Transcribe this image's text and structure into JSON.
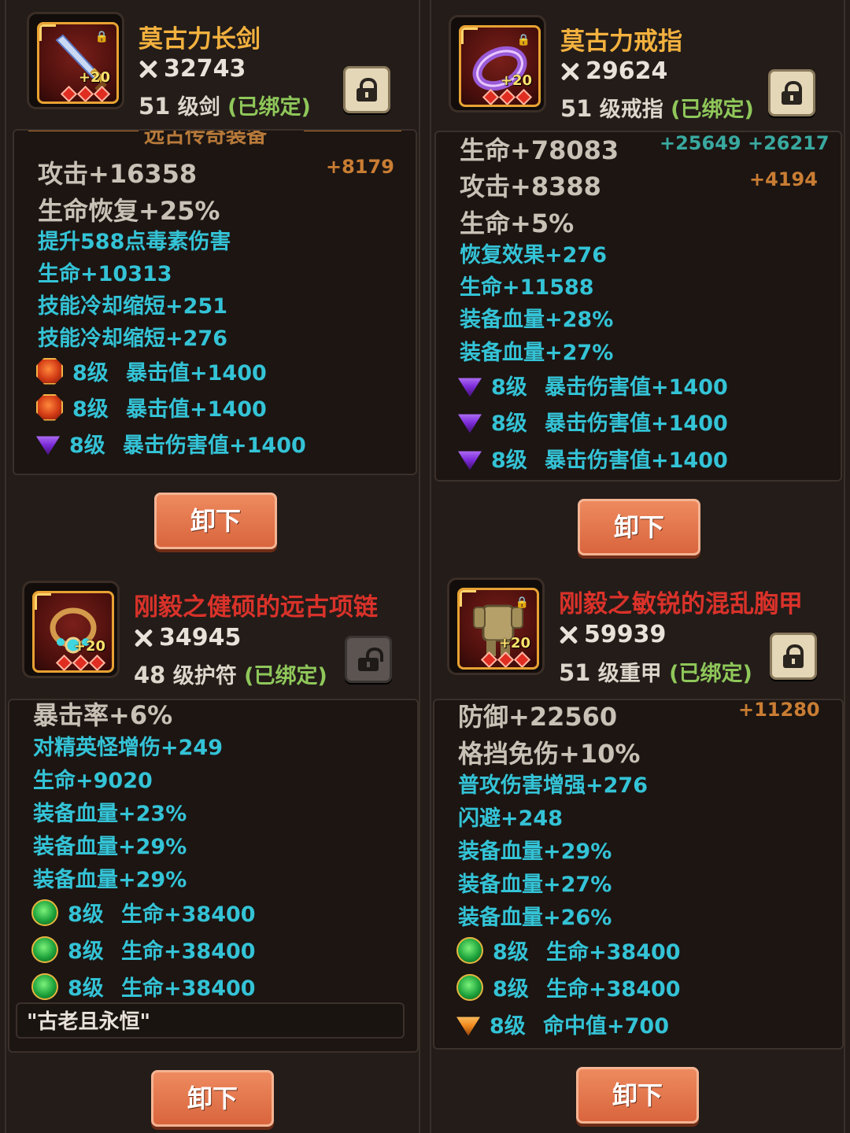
{
  "unequip_label": "卸下",
  "panels": [
    {
      "name": "莫古力长剑",
      "power": "32743",
      "level": "51",
      "level_text": " 级剑 ",
      "bound": "(已绑定)",
      "icon_level": "+20",
      "section_title": "远古传奇装备",
      "stats": [
        {
          "text": "攻击+16358",
          "bonus": "+8179"
        },
        {
          "text": "生命恢复+25%"
        },
        {
          "text": "提升588点毒素伤害"
        },
        {
          "text": "生命+10313"
        },
        {
          "text": "技能冷却缩短+251"
        },
        {
          "text": "技能冷却缩短+276"
        }
      ],
      "gems": [
        {
          "level": "8级",
          "text": "暴击值+1400",
          "icon": "red-gem-icon"
        },
        {
          "level": "8级",
          "text": "暴击值+1400",
          "icon": "red-gem-icon"
        },
        {
          "level": "8级",
          "text": "暴击伤害值+1400",
          "icon": "purple-gem-icon"
        }
      ]
    },
    {
      "name": "莫古力戒指",
      "power": "29624",
      "level": "51",
      "level_text": " 级戒指 ",
      "bound": "(已绑定)",
      "icon_level": "+20",
      "stats": [
        {
          "text": "生命+78083",
          "bonus": "+25649 +26217"
        },
        {
          "text": "攻击+8388",
          "bonus": "+4194"
        },
        {
          "text": "生命+5%"
        },
        {
          "text": "恢复效果+276"
        },
        {
          "text": "生命+11588"
        },
        {
          "text": "装备血量+28%"
        },
        {
          "text": "装备血量+27%"
        }
      ],
      "gems": [
        {
          "level": "8级",
          "text": "暴击伤害值+1400",
          "icon": "purple-gem-icon"
        },
        {
          "level": "8级",
          "text": "暴击伤害值+1400",
          "icon": "purple-gem-icon"
        },
        {
          "level": "8级",
          "text": "暴击伤害值+1400",
          "icon": "purple-gem-icon"
        }
      ]
    },
    {
      "name": "刚毅之健硕的远古项链",
      "power": "34945",
      "level": "48",
      "level_text": " 级护符 ",
      "bound": "(已绑定)",
      "icon_level": "+20",
      "stats": [
        {
          "text": "暴击率+6%"
        },
        {
          "text": "对精英怪增伤+249"
        },
        {
          "text": "生命+9020"
        },
        {
          "text": "装备血量+23%"
        },
        {
          "text": "装备血量+29%"
        },
        {
          "text": "装备血量+29%"
        }
      ],
      "gems": [
        {
          "level": "8级",
          "text": "生命+38400",
          "icon": "green-gem-icon"
        },
        {
          "level": "8级",
          "text": "生命+38400",
          "icon": "green-gem-icon"
        },
        {
          "level": "8级",
          "text": "生命+38400",
          "icon": "green-gem-icon"
        }
      ],
      "motto": "\"古老且永恒\""
    },
    {
      "name": "刚毅之敏锐的混乱胸甲",
      "power": "59939",
      "level": "51",
      "level_text": " 级重甲 ",
      "bound": "(已绑定)",
      "icon_level": "+20",
      "stats": [
        {
          "text": "防御+22560",
          "bonus": "+11280"
        },
        {
          "text": "格挡免伤+10%"
        },
        {
          "text": "普攻伤害增强+276"
        },
        {
          "text": "闪避+248"
        },
        {
          "text": "装备血量+29%"
        },
        {
          "text": "装备血量+27%"
        },
        {
          "text": "装备血量+26%"
        }
      ],
      "gems": [
        {
          "level": "8级",
          "text": "生命+38400",
          "icon": "green-gem-icon"
        },
        {
          "level": "8级",
          "text": "生命+38400",
          "icon": "green-gem-icon"
        },
        {
          "level": "8级",
          "text": "命中值+700",
          "icon": "orange-gem-icon"
        }
      ]
    }
  ]
}
